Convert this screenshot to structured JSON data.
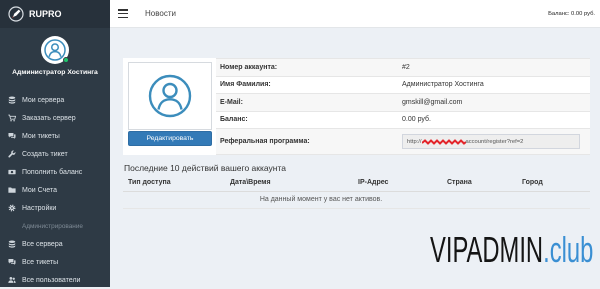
{
  "brand": {
    "name": "RUPRO",
    "logo_icon": "rocket-logo-icon"
  },
  "header": {
    "title": "Новости",
    "balance": "Баланс: 0.00 руб.",
    "menu_icon": "hamburger-icon"
  },
  "user": {
    "name": "Администратор Хостинга",
    "avatar_icon": "user-icon"
  },
  "sidebar": {
    "items": [
      {
        "label": "Мои сервера",
        "icon": "database-icon"
      },
      {
        "label": "Заказать сервер",
        "icon": "cart-icon"
      },
      {
        "label": "Мои тикеты",
        "icon": "comments-icon"
      },
      {
        "label": "Создать тикет",
        "icon": "wrench-icon"
      },
      {
        "label": "Пополнить баланс",
        "icon": "money-icon"
      },
      {
        "label": "Мои Счета",
        "icon": "folder-icon"
      },
      {
        "label": "Настройки",
        "icon": "gear-icon"
      }
    ],
    "admin_header": "Администрирование",
    "admin_items": [
      {
        "label": "Все сервера",
        "icon": "database-icon"
      },
      {
        "label": "Все тикеты",
        "icon": "comments-icon"
      },
      {
        "label": "Все пользователи",
        "icon": "users-icon"
      }
    ]
  },
  "profile": {
    "edit_label": "Редактировать",
    "fields": [
      {
        "label": "Номер аккаунта:",
        "value": "#2"
      },
      {
        "label": "Имя Фамилия:",
        "value": "Администратор Хостинга"
      },
      {
        "label": "E-Mail:",
        "value": "gmskill@gmail.com"
      },
      {
        "label": "Баланс:",
        "value": "0.00 руб."
      }
    ],
    "referral": {
      "label": "Реферальная программа:",
      "prefix": "http://",
      "suffix": "account/register?ref=2"
    }
  },
  "activity": {
    "title": "Последние 10 действий вашего аккаунта",
    "columns": [
      "Тип доступа",
      "Дата\\Время",
      "IP-Адрес",
      "Страна",
      "Город"
    ],
    "empty": "На данный момент у вас нет активов."
  },
  "watermark": {
    "text": "VIPADMIN",
    "suffix": ".club"
  },
  "colors": {
    "logo_area": "#27313b",
    "sidebar": "#2e3a45",
    "accent": "#3c8dbc",
    "button": "#337ab7",
    "online_indicator": "#1fc46b",
    "redaction": "#e3252b",
    "watermark_accent": "#3a8fd3"
  }
}
